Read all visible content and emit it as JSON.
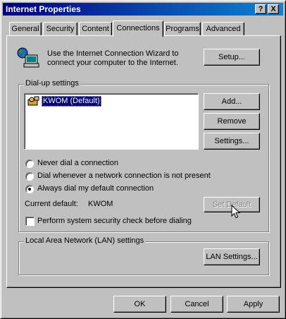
{
  "window": {
    "title": "Internet Properties",
    "help_button": "?",
    "close_button": "X"
  },
  "tabs": [
    {
      "label": "General",
      "active": false
    },
    {
      "label": "Security",
      "active": false
    },
    {
      "label": "Content",
      "active": false
    },
    {
      "label": "Connections",
      "active": true
    },
    {
      "label": "Programs",
      "active": false
    },
    {
      "label": "Advanced",
      "active": false
    }
  ],
  "wizard": {
    "text": "Use the Internet Connection Wizard to connect your computer to the Internet.",
    "setup_button": "Setup..."
  },
  "dialup": {
    "group_label": "Dial-up settings",
    "connections": [
      {
        "label": "KWOM (Default)",
        "selected": true
      }
    ],
    "add_button": "Add...",
    "remove_button": "Remove",
    "settings_button": "Settings...",
    "options": [
      {
        "label": "Never dial a connection",
        "selected": false
      },
      {
        "label": "Dial whenever a network connection is not present",
        "selected": false
      },
      {
        "label": "Always dial my default connection",
        "selected": true
      }
    ],
    "current_default_label": "Current default:",
    "current_default_value": "KWOM",
    "set_default_button": "Set Default",
    "set_default_enabled": false,
    "security_check_label": "Perform system security check before dialing",
    "security_check_checked": false
  },
  "lan": {
    "group_label": "Local Area Network (LAN) settings",
    "lan_settings_button": "LAN Settings..."
  },
  "footer": {
    "ok_button": "OK",
    "cancel_button": "Cancel",
    "apply_button": "Apply"
  },
  "colors": {
    "face": "#c0c0c0",
    "titlebar_start": "#000080",
    "titlebar_end": "#1084d0",
    "selection": "#000080"
  }
}
